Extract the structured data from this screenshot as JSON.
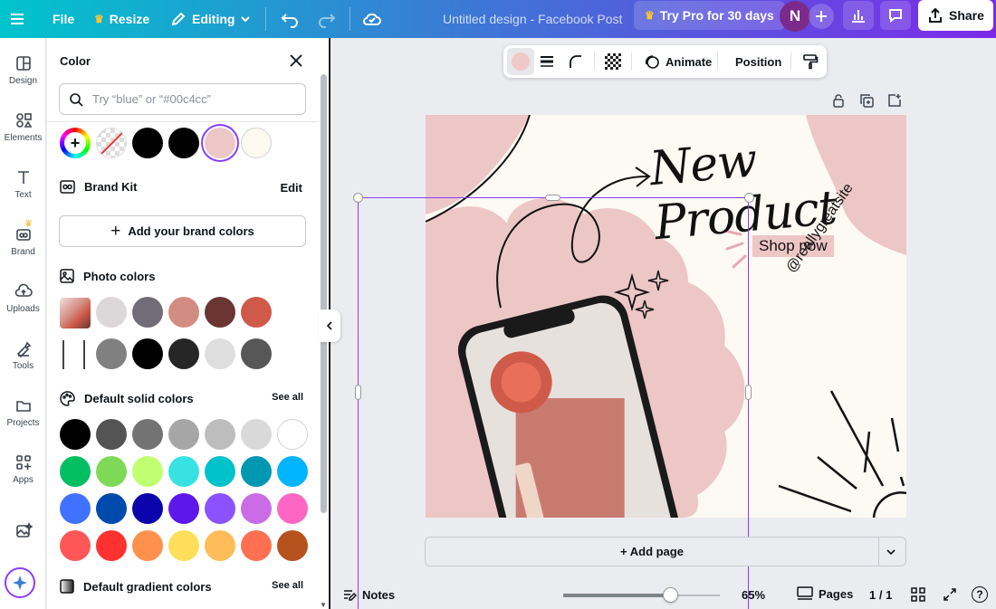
{
  "topbar": {
    "file": "File",
    "resize": "Resize",
    "editing": "Editing",
    "doc_title": "Untitled design - Facebook Post",
    "try_pro": "Try Pro for 30 days",
    "avatar": "N",
    "share": "Share"
  },
  "rail": {
    "items": [
      {
        "label": "Design",
        "icon": "design-icon"
      },
      {
        "label": "Elements",
        "icon": "elements-icon"
      },
      {
        "label": "Text",
        "icon": "text-icon"
      },
      {
        "label": "Brand",
        "icon": "brand-icon"
      },
      {
        "label": "Uploads",
        "icon": "uploads-icon"
      },
      {
        "label": "Tools",
        "icon": "tools-icon"
      },
      {
        "label": "Projects",
        "icon": "projects-icon"
      },
      {
        "label": "Apps",
        "icon": "apps-icon"
      }
    ]
  },
  "panel": {
    "title": "Color",
    "search_placeholder": "Try “blue” or “#00c4cc”",
    "doc_colors": [
      "#000000",
      "#000000",
      "#edc6c6",
      "#fcf9f0"
    ],
    "brand_kit": "Brand Kit",
    "brand_edit": "Edit",
    "add_brand": "Add your brand colors",
    "photo_colors": "Photo colors",
    "photo_row1": [
      "#dcd7d8",
      "#706c78",
      "#d38c81",
      "#6b3532",
      "#cf5a4a"
    ],
    "photo_row2": [
      "#808080",
      "#000000",
      "#262626",
      "#dedede",
      "#575757"
    ],
    "default_solid": "Default solid colors",
    "see_all": "See all",
    "solid_rows": [
      [
        "#000000",
        "#545454",
        "#737373",
        "#a6a6a6",
        "#bdbdbd",
        "#d9d9d9",
        "#ffffff"
      ],
      [
        "#00bf63",
        "#7ed957",
        "#c1ff72",
        "#38e2e2",
        "#00c2cb",
        "#0097b2",
        "#00b4ff"
      ],
      [
        "#4171ff",
        "#004aad",
        "#0b03ab",
        "#5e17eb",
        "#8c52ff",
        "#cb6ce6",
        "#ff66c4"
      ],
      [
        "#ff5757",
        "#ff3131",
        "#ff914d",
        "#ffde59",
        "#ffbd59",
        "#ff7052",
        "#b5521e"
      ]
    ],
    "default_gradient": "Default gradient colors",
    "see_all2": "See all"
  },
  "toolbar": {
    "fill_color": "#efc8c8",
    "animate": "Animate",
    "position": "Position"
  },
  "design": {
    "headline": "New Product",
    "shop_now": "Shop now",
    "handle": "@reallygreatsite"
  },
  "bottom": {
    "add_page": "+ Add page",
    "notes": "Notes",
    "zoom": "65%",
    "zoom_fraction": 0.65,
    "pages": "Pages",
    "page_count": "1 / 1"
  },
  "colors": {
    "accent_purple": "#8b3dff",
    "blob_pink": "#edc6c6",
    "avatar_bg": "#7b2a8b"
  }
}
